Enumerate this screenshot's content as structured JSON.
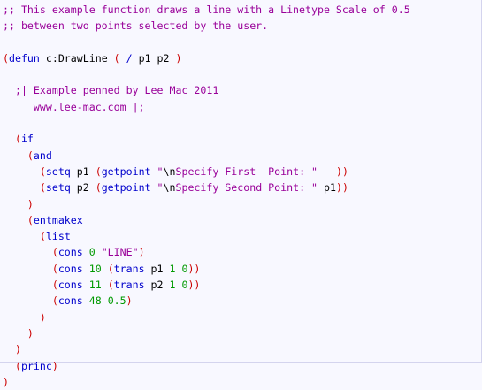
{
  "code": {
    "language": "AutoLISP",
    "lines": [
      [
        {
          "kind": "comment",
          "text": ";; This example function draws a line with a Linetype Scale of 0.5"
        }
      ],
      [
        {
          "kind": "comment",
          "text": ";; between two points selected by the user."
        }
      ],
      [],
      [
        {
          "kind": "paren",
          "text": "("
        },
        {
          "kind": "func",
          "text": "defun"
        },
        {
          "kind": "plain",
          "text": " c:DrawLine "
        },
        {
          "kind": "paren",
          "text": "("
        },
        {
          "kind": "plain",
          "text": " "
        },
        {
          "kind": "slash",
          "text": "/"
        },
        {
          "kind": "plain",
          "text": " p1 p2 "
        },
        {
          "kind": "paren",
          "text": ")"
        }
      ],
      [],
      [
        {
          "kind": "plain",
          "text": "  "
        },
        {
          "kind": "comment",
          "text": ";| Example penned by Lee Mac 2011"
        }
      ],
      [
        {
          "kind": "comment",
          "text": "     www.lee-mac.com |;"
        }
      ],
      [],
      [
        {
          "kind": "plain",
          "text": "  "
        },
        {
          "kind": "paren",
          "text": "("
        },
        {
          "kind": "func",
          "text": "if"
        }
      ],
      [
        {
          "kind": "plain",
          "text": "    "
        },
        {
          "kind": "paren",
          "text": "("
        },
        {
          "kind": "func",
          "text": "and"
        }
      ],
      [
        {
          "kind": "plain",
          "text": "      "
        },
        {
          "kind": "paren",
          "text": "("
        },
        {
          "kind": "func",
          "text": "setq"
        },
        {
          "kind": "plain",
          "text": " p1 "
        },
        {
          "kind": "paren",
          "text": "("
        },
        {
          "kind": "func",
          "text": "getpoint"
        },
        {
          "kind": "plain",
          "text": " "
        },
        {
          "kind": "string",
          "text": "\""
        },
        {
          "kind": "escape",
          "text": "\\n"
        },
        {
          "kind": "string",
          "text": "Specify First  Point: \""
        },
        {
          "kind": "plain",
          "text": "   "
        },
        {
          "kind": "paren",
          "text": "))"
        }
      ],
      [
        {
          "kind": "plain",
          "text": "      "
        },
        {
          "kind": "paren",
          "text": "("
        },
        {
          "kind": "func",
          "text": "setq"
        },
        {
          "kind": "plain",
          "text": " p2 "
        },
        {
          "kind": "paren",
          "text": "("
        },
        {
          "kind": "func",
          "text": "getpoint"
        },
        {
          "kind": "plain",
          "text": " "
        },
        {
          "kind": "string",
          "text": "\""
        },
        {
          "kind": "escape",
          "text": "\\n"
        },
        {
          "kind": "string",
          "text": "Specify Second Point: \""
        },
        {
          "kind": "plain",
          "text": " p1"
        },
        {
          "kind": "paren",
          "text": "))"
        }
      ],
      [
        {
          "kind": "plain",
          "text": "    "
        },
        {
          "kind": "paren",
          "text": ")"
        }
      ],
      [
        {
          "kind": "plain",
          "text": "    "
        },
        {
          "kind": "paren",
          "text": "("
        },
        {
          "kind": "func",
          "text": "entmakex"
        }
      ],
      [
        {
          "kind": "plain",
          "text": "      "
        },
        {
          "kind": "paren",
          "text": "("
        },
        {
          "kind": "func",
          "text": "list"
        }
      ],
      [
        {
          "kind": "plain",
          "text": "        "
        },
        {
          "kind": "paren",
          "text": "("
        },
        {
          "kind": "func",
          "text": "cons"
        },
        {
          "kind": "plain",
          "text": " "
        },
        {
          "kind": "number",
          "text": "0"
        },
        {
          "kind": "plain",
          "text": " "
        },
        {
          "kind": "string",
          "text": "\"LINE\""
        },
        {
          "kind": "paren",
          "text": ")"
        }
      ],
      [
        {
          "kind": "plain",
          "text": "        "
        },
        {
          "kind": "paren",
          "text": "("
        },
        {
          "kind": "func",
          "text": "cons"
        },
        {
          "kind": "plain",
          "text": " "
        },
        {
          "kind": "number",
          "text": "10"
        },
        {
          "kind": "plain",
          "text": " "
        },
        {
          "kind": "paren",
          "text": "("
        },
        {
          "kind": "func",
          "text": "trans"
        },
        {
          "kind": "plain",
          "text": " p1 "
        },
        {
          "kind": "number",
          "text": "1"
        },
        {
          "kind": "plain",
          "text": " "
        },
        {
          "kind": "number",
          "text": "0"
        },
        {
          "kind": "paren",
          "text": "))"
        }
      ],
      [
        {
          "kind": "plain",
          "text": "        "
        },
        {
          "kind": "paren",
          "text": "("
        },
        {
          "kind": "func",
          "text": "cons"
        },
        {
          "kind": "plain",
          "text": " "
        },
        {
          "kind": "number",
          "text": "11"
        },
        {
          "kind": "plain",
          "text": " "
        },
        {
          "kind": "paren",
          "text": "("
        },
        {
          "kind": "func",
          "text": "trans"
        },
        {
          "kind": "plain",
          "text": " p2 "
        },
        {
          "kind": "number",
          "text": "1"
        },
        {
          "kind": "plain",
          "text": " "
        },
        {
          "kind": "number",
          "text": "0"
        },
        {
          "kind": "paren",
          "text": "))"
        }
      ],
      [
        {
          "kind": "plain",
          "text": "        "
        },
        {
          "kind": "paren",
          "text": "("
        },
        {
          "kind": "func",
          "text": "cons"
        },
        {
          "kind": "plain",
          "text": " "
        },
        {
          "kind": "number",
          "text": "48"
        },
        {
          "kind": "plain",
          "text": " "
        },
        {
          "kind": "number",
          "text": "0.5"
        },
        {
          "kind": "paren",
          "text": ")"
        }
      ],
      [
        {
          "kind": "plain",
          "text": "      "
        },
        {
          "kind": "paren",
          "text": ")"
        }
      ],
      [
        {
          "kind": "plain",
          "text": "    "
        },
        {
          "kind": "paren",
          "text": ")"
        }
      ],
      [
        {
          "kind": "plain",
          "text": "  "
        },
        {
          "kind": "paren",
          "text": ")"
        }
      ],
      [
        {
          "kind": "plain",
          "text": "  "
        },
        {
          "kind": "paren",
          "text": "("
        },
        {
          "kind": "func",
          "text": "princ"
        },
        {
          "kind": "paren",
          "text": ")"
        }
      ],
      [
        {
          "kind": "paren",
          "text": ")"
        }
      ]
    ]
  },
  "colors": {
    "background": "#f8f8ff",
    "comment": "#990099",
    "paren": "#cc0000",
    "function": "#0000cc",
    "string": "#990099",
    "number": "#009900",
    "plain": "#000000"
  }
}
